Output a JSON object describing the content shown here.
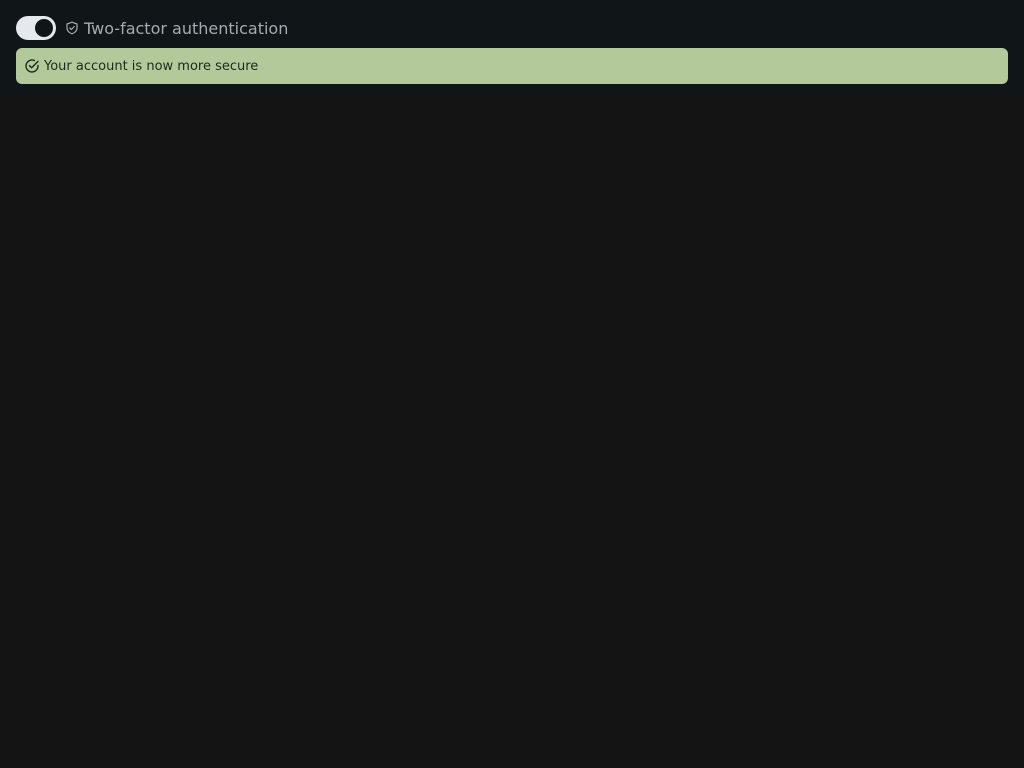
{
  "setting": {
    "label": "Two-factor authentication",
    "enabled": true,
    "icon": "shield-check-icon"
  },
  "banner": {
    "message": "Your account is now more secure",
    "icon": "circle-check-icon",
    "status": "success"
  },
  "colors": {
    "page_background": "#141414",
    "panel_background": "#101517",
    "toggle_track_on": "#e5e8ec",
    "toggle_knob": "#101517",
    "label_text": "#a6abb1",
    "banner_background": "#b4c99a",
    "banner_text": "#1e2a1c"
  }
}
